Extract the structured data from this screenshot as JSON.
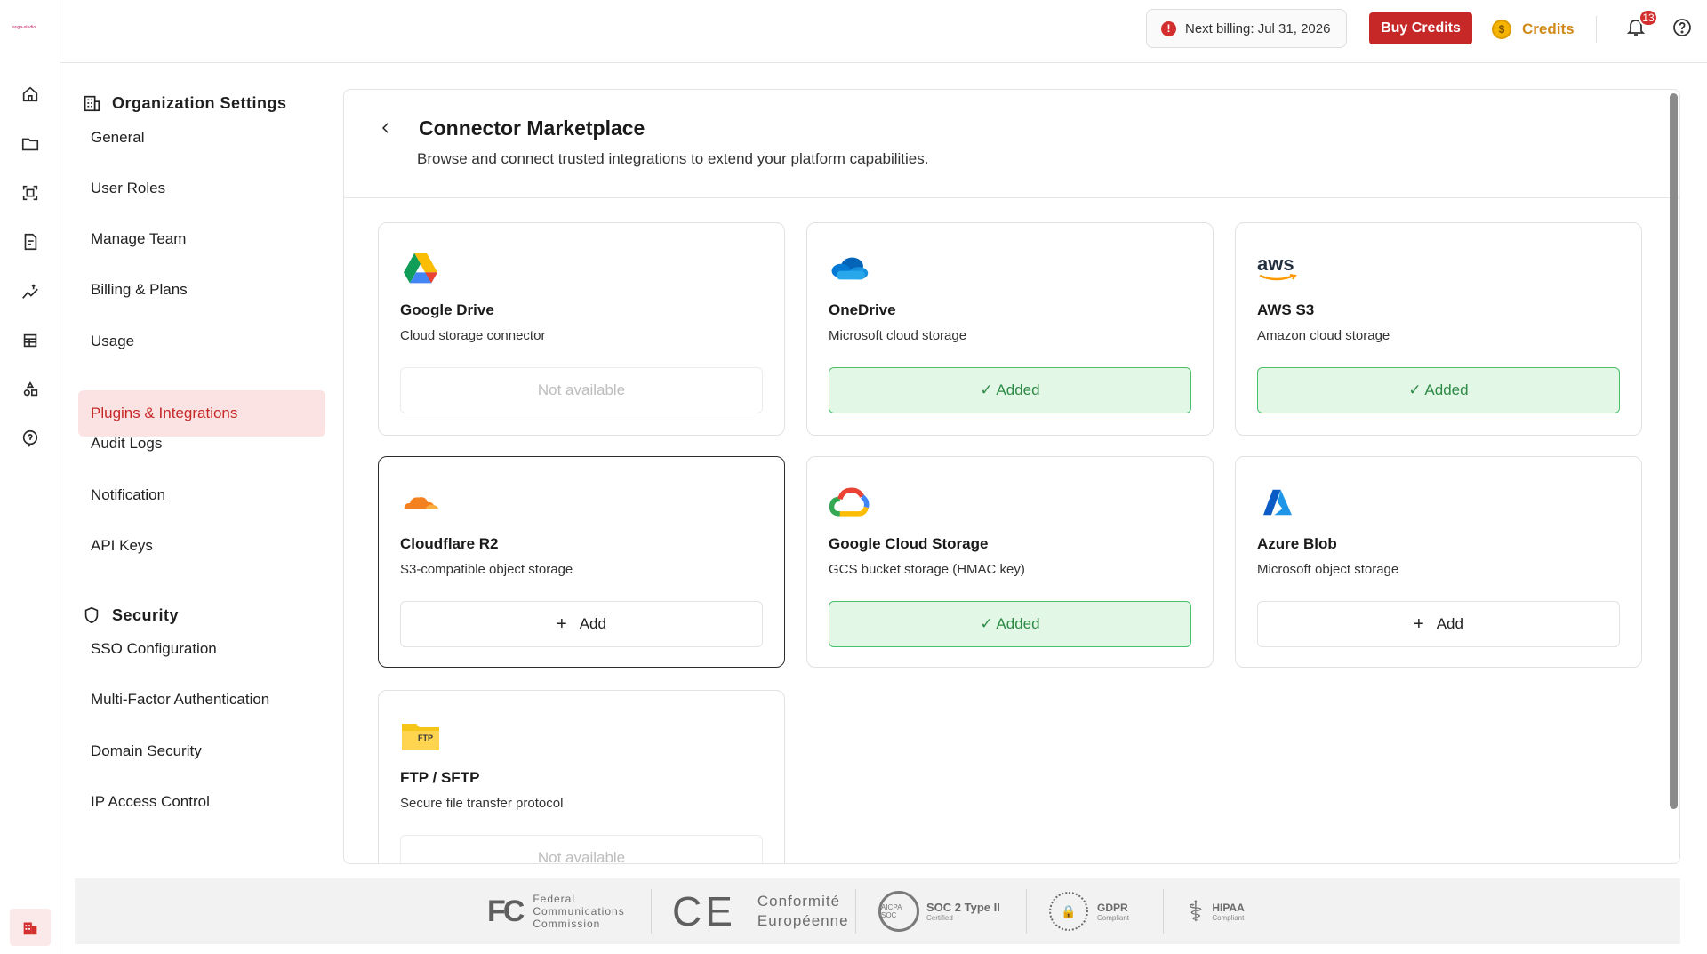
{
  "app": {
    "logo_text": "auga-studio"
  },
  "topbar": {
    "billing_text": "Next billing: Jul 31, 2026",
    "billing_alert_icon": "!",
    "buy_label": "Buy Credits",
    "credits_label": "Credits",
    "coin_symbol": "$",
    "notification_count": "13"
  },
  "settings": {
    "org_heading": "Organization Settings",
    "org_items": [
      {
        "label": "General"
      },
      {
        "label": "User Roles"
      },
      {
        "label": "Manage Team"
      },
      {
        "label": "Billing & Plans"
      },
      {
        "label": "Usage"
      },
      {
        "label": "Plugins & Integrations"
      },
      {
        "label": "Audit Logs"
      },
      {
        "label": "Notification"
      },
      {
        "label": "API Keys"
      }
    ],
    "security_heading": "Security",
    "security_items": [
      {
        "label": "SSO Configuration"
      },
      {
        "label": "Multi-Factor Authentication"
      },
      {
        "label": "Domain Security"
      },
      {
        "label": "IP Access Control"
      }
    ],
    "active_item": "Plugins & Integrations"
  },
  "marketplace": {
    "title": "Connector Marketplace",
    "subtitle": "Browse and connect trusted integrations to extend your platform capabilities.",
    "connectors": [
      {
        "name": "Google Drive",
        "desc": "Cloud storage connector",
        "status": "Not available",
        "icon": "google-drive-icon"
      },
      {
        "name": "OneDrive",
        "desc": "Microsoft cloud storage",
        "status": "✓ Added",
        "icon": "onedrive-icon"
      },
      {
        "name": "AWS S3",
        "desc": "Amazon cloud storage",
        "status": "✓ Added",
        "icon": "aws-icon",
        "logo_text": "aws"
      },
      {
        "name": "Cloudflare R2",
        "desc": "S3-compatible object storage",
        "status": "Add",
        "icon": "cloudflare-icon"
      },
      {
        "name": "Google Cloud Storage",
        "desc": "GCS bucket storage (HMAC key)",
        "status": "✓ Added",
        "icon": "google-cloud-icon"
      },
      {
        "name": "Azure Blob",
        "desc": "Microsoft object storage",
        "status": "Add",
        "icon": "azure-icon"
      },
      {
        "name": "FTP / SFTP",
        "desc": "Secure file transfer protocol",
        "status": "Not available",
        "icon": "ftp-folder-icon",
        "logo_text": "FTP"
      }
    ]
  },
  "footer": {
    "fcc_mark": "FC",
    "fcc_line1": "Federal",
    "fcc_line2": "Communications",
    "fcc_line3": "Commission",
    "ce_mark": "CE",
    "ce_line1": "Conformité",
    "ce_line2": "Européenne",
    "soc_badge": "AICPA SOC",
    "soc_title": "SOC 2 Type II",
    "soc_sub": "Certified",
    "gdpr_title": "GDPR",
    "gdpr_sub": "Compliant",
    "hipaa_title": "HIPAA",
    "hipaa_sub": "Compliant"
  },
  "colors": {
    "accent": "#c62828",
    "active_bg": "#fbe3e3",
    "added_bg": "#e3f7e7",
    "added_border": "#49c06a",
    "credits": "#d08a1a"
  }
}
